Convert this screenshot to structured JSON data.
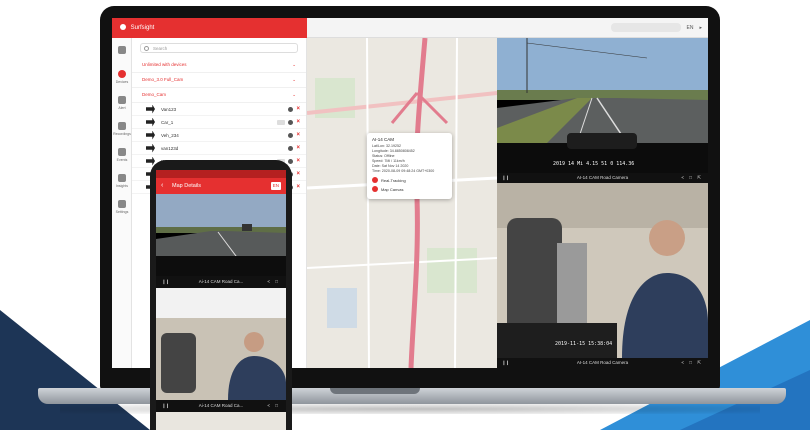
{
  "app": {
    "brand": "Surfsight",
    "top_right_label": "EN"
  },
  "rail": {
    "items": [
      {
        "label": "",
        "icon": "grid-icon"
      },
      {
        "label": "Devices",
        "icon": "map-pin-icon"
      },
      {
        "label": "Alert",
        "icon": "alert-icon"
      },
      {
        "label": "Recordings",
        "icon": "video-icon"
      },
      {
        "label": "Events",
        "icon": "document-icon"
      },
      {
        "label": "Insights",
        "icon": "chart-icon"
      },
      {
        "label": "Settings",
        "icon": "gear-icon"
      }
    ]
  },
  "vehicle_list": {
    "search_placeholder": "Search",
    "groups": [
      {
        "label": "Unlimited with devices"
      },
      {
        "label": "Demo_3.0 Full_Cam"
      },
      {
        "label": "Demo_Cam"
      }
    ],
    "vehicles": [
      {
        "name": "Van123"
      },
      {
        "name": "Car_1"
      },
      {
        "name": "Veh_234"
      },
      {
        "name": "van123d"
      },
      {
        "name": "Van_Co"
      },
      {
        "name": "Ai-14 VLM"
      },
      {
        "name": "Ready_Veh_1"
      }
    ]
  },
  "map": {
    "popup": {
      "title": "AI-14 CAM",
      "lines": [
        "Lat/Lon: 32.19252",
        "Longitude: 34.8850808452",
        "Status: Offline",
        "Speed: 7Mi / 11km/h",
        "Date: Sat Nov 14 2020",
        "Time: 2020-08-09 09:48:24 GMT+0300"
      ],
      "actions": [
        "Real-Tracking",
        "Map Canvas"
      ]
    }
  },
  "videos": {
    "road_label": "AI-14 CAM Road Camera",
    "cabin_label": "AI-14 CAM Road Camera",
    "road_overlay": "2019 14 Mi 4.15 51 0 114.36",
    "cabin_overlay": "2019-11-15 15:38:04"
  },
  "phone": {
    "header_title": "Map Details",
    "header_badge": "EN",
    "road_label": "Ai-14 CAM Road Ca...",
    "cabin_label": "Ai-14 CAM Road Ca..."
  },
  "colors": {
    "brand_red": "#e53030",
    "navy": "#1d3556",
    "blue": "#2f8fd8"
  }
}
